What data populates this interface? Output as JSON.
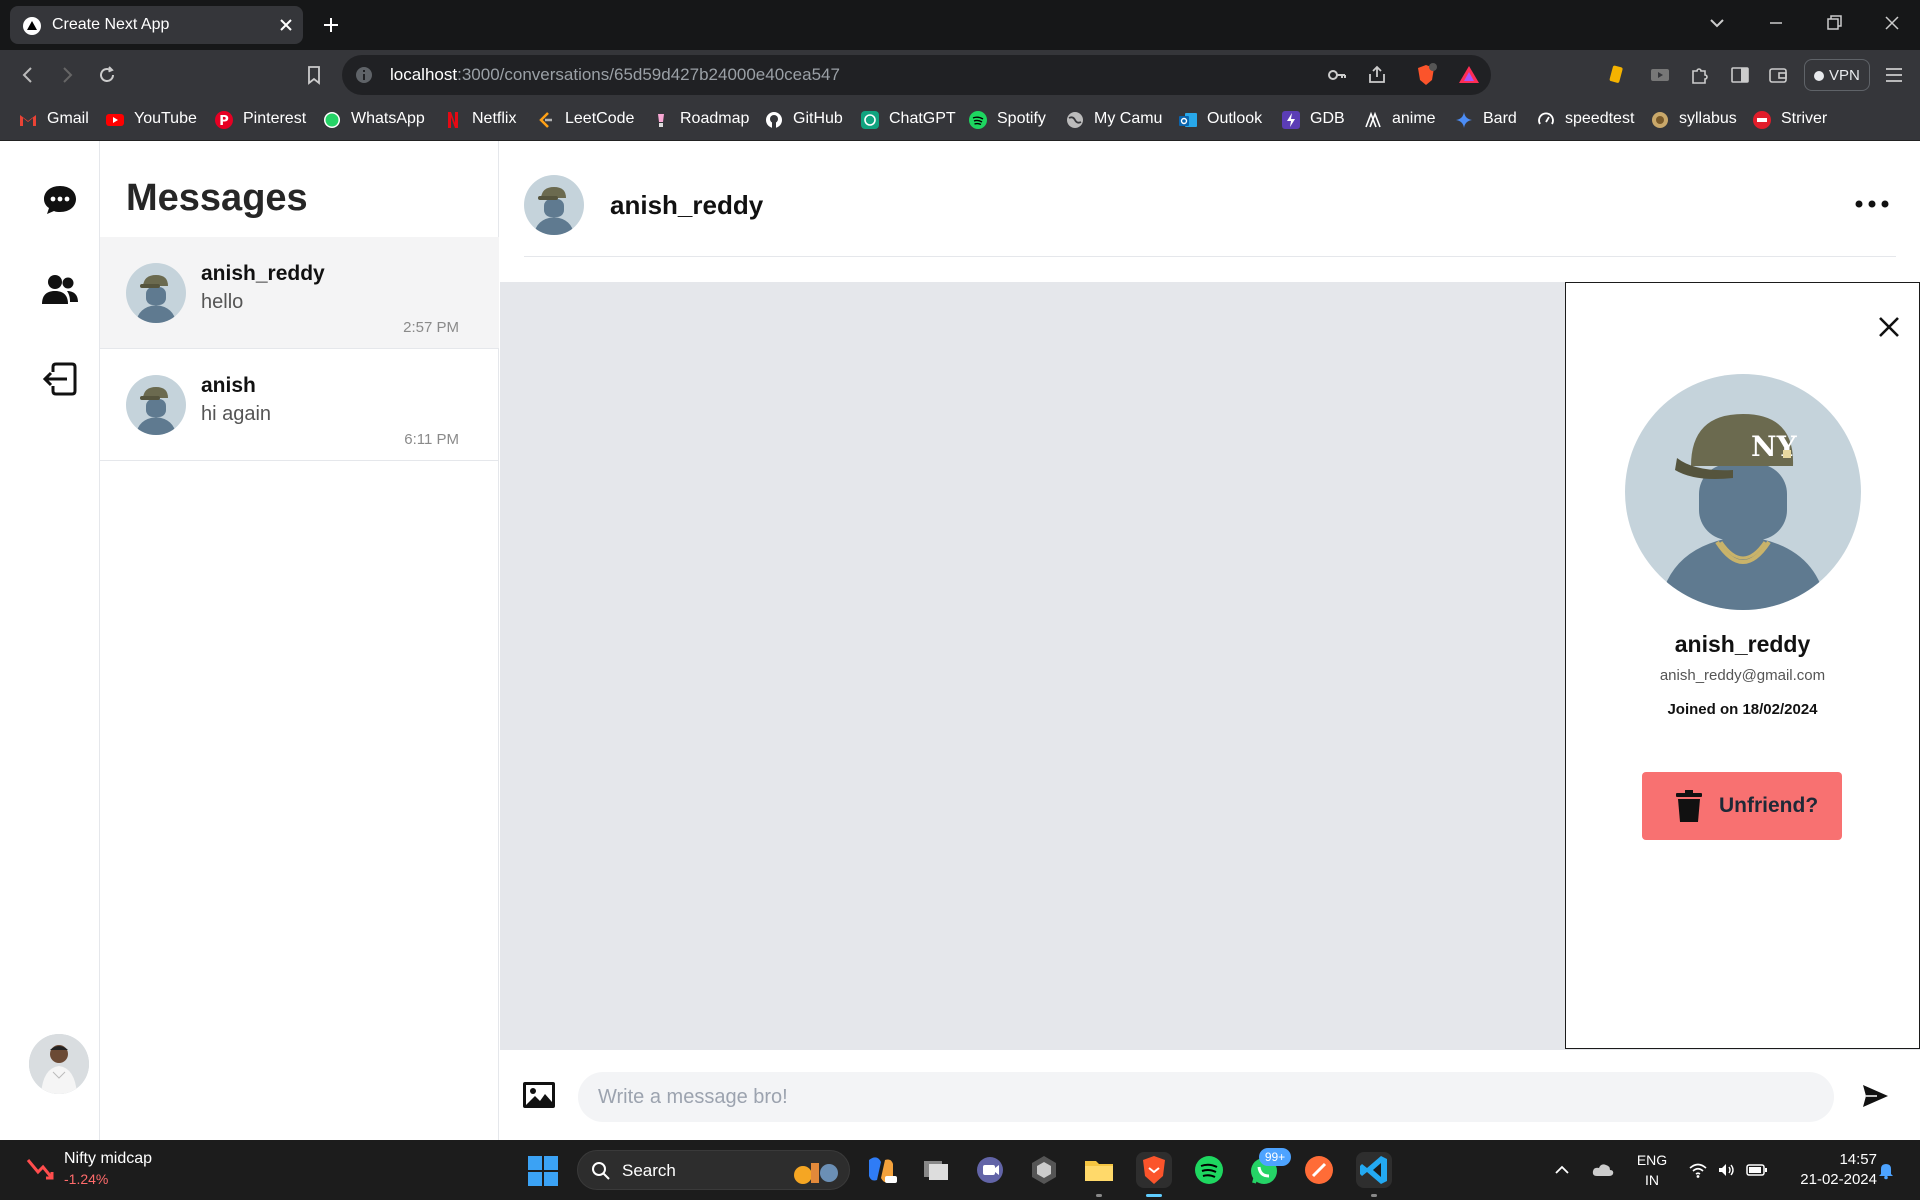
{
  "browser": {
    "tab_title": "Create Next App",
    "url_host": "localhost",
    "url_rest": ":3000/conversations/65d59d427b24000e40cea547",
    "vpn_label": "VPN",
    "bookmarks": [
      "Gmail",
      "YouTube",
      "Pinterest",
      "WhatsApp",
      "Netflix",
      "LeetCode",
      "Roadmap",
      "GitHub",
      "ChatGPT",
      "Spotify",
      "My Camu",
      "Outlook",
      "GDB",
      "anime",
      "Bard",
      "speedtest",
      "syllabus",
      "Striver"
    ]
  },
  "sidebar": {
    "title": "Messages",
    "conversations": [
      {
        "name": "anish_reddy",
        "last_message": "hello",
        "time": "2:57 PM"
      },
      {
        "name": "anish",
        "last_message": "hi again",
        "time": "6:11 PM"
      }
    ]
  },
  "chat": {
    "header_name": "anish_reddy",
    "input_placeholder": "Write a message bro!"
  },
  "profile": {
    "name": "anish_reddy",
    "email": "anish_reddy@gmail.com",
    "joined": "Joined on 18/02/2024",
    "unfriend_label": "Unfriend?"
  },
  "taskbar": {
    "widget_title": "Nifty midcap",
    "widget_value": "-1.24%",
    "search_label": "Search",
    "whatsapp_badge": "99+",
    "lang_line1": "ENG",
    "lang_line2": "IN",
    "time": "14:57",
    "date": "21-02-2024"
  },
  "colors": {
    "accent_unfriend": "#f87171",
    "chat_bg": "#e5e7eb"
  }
}
